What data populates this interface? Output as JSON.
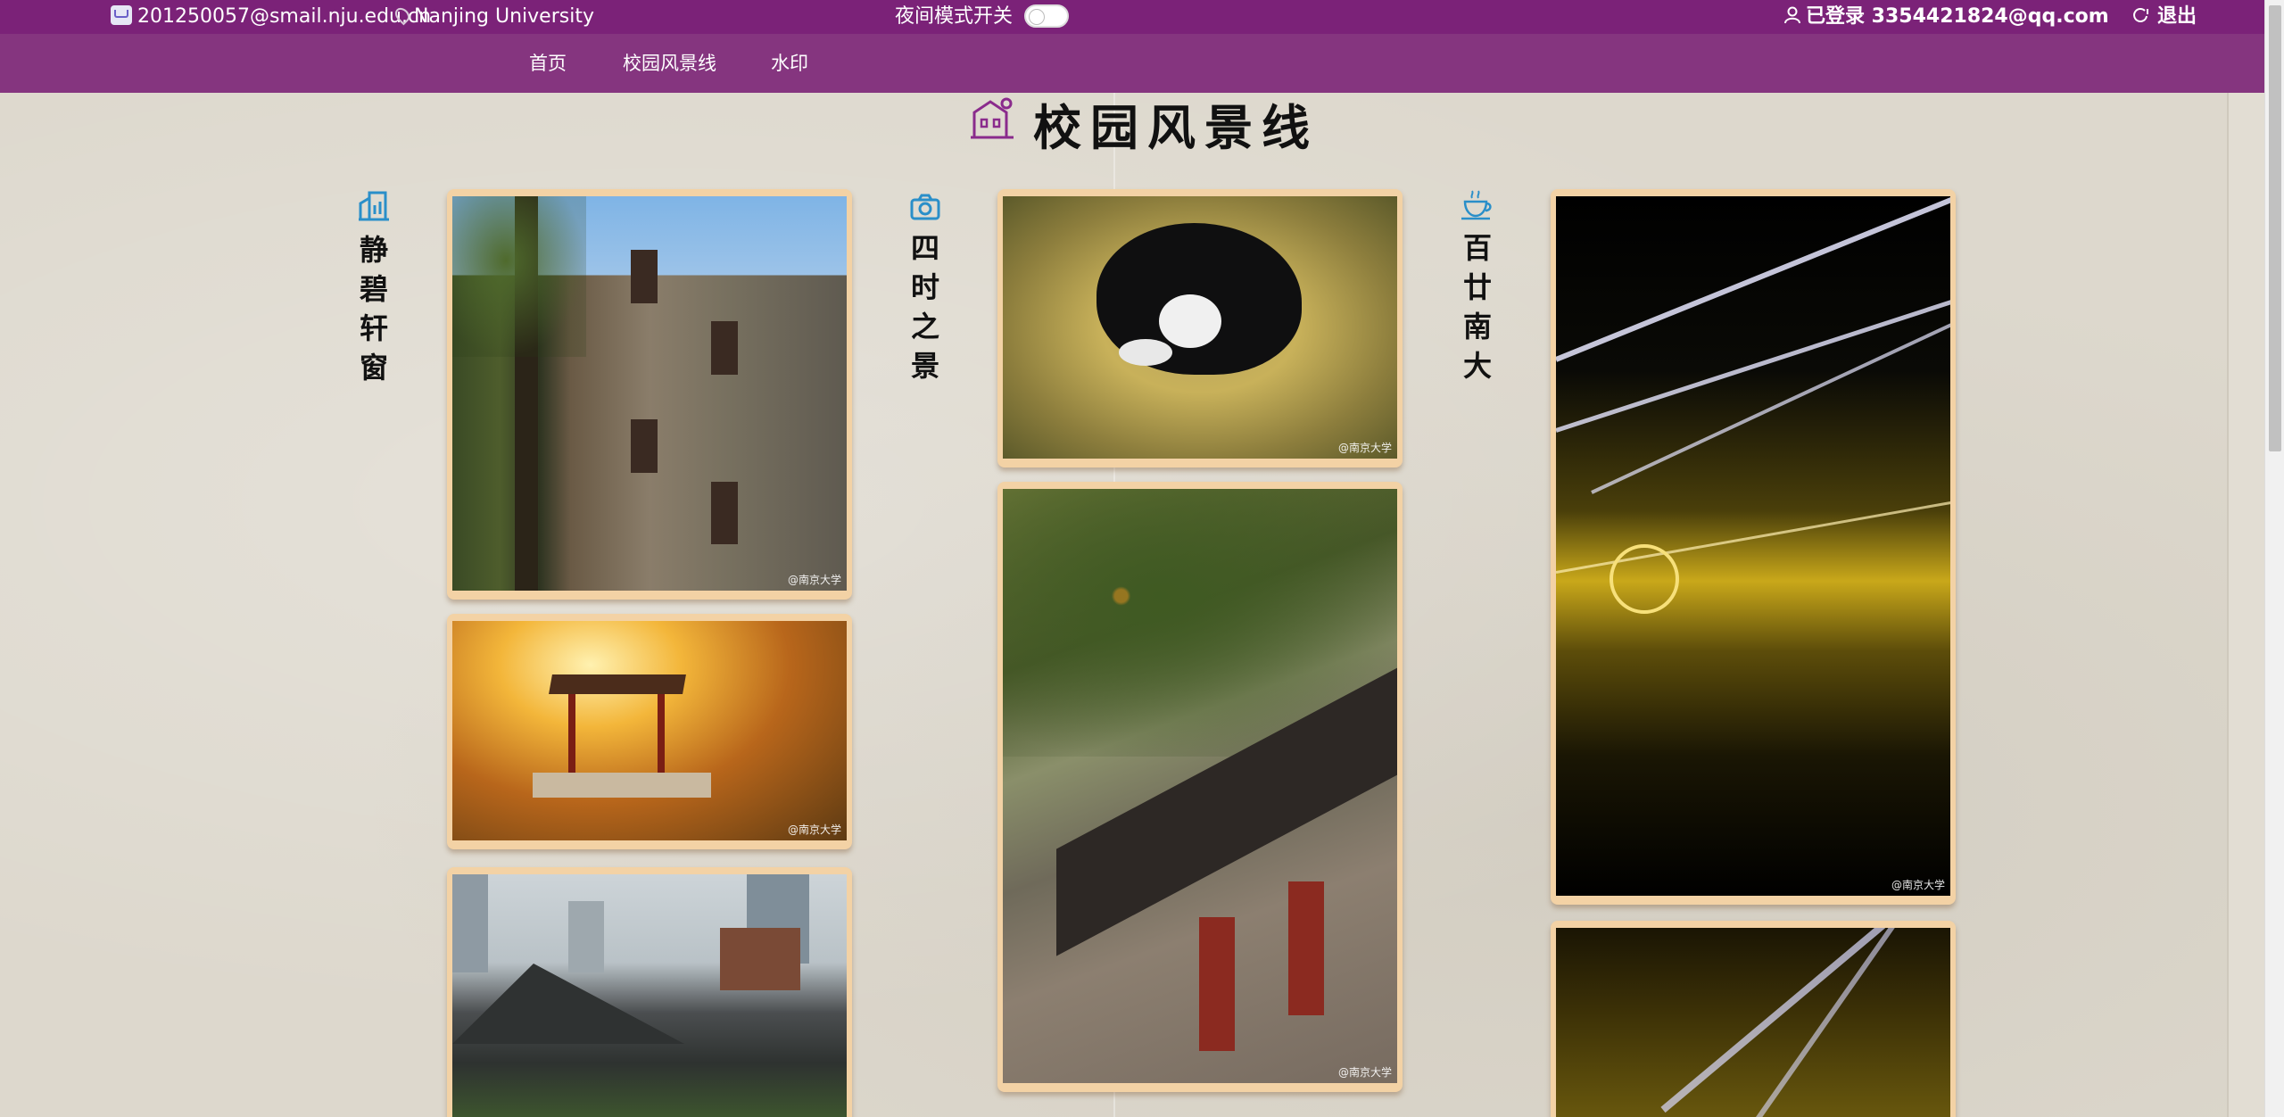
{
  "topbar": {
    "email": "201250057@smail.nju.edu.cn",
    "location": "Nanjing University",
    "night_mode_label": "夜间模式开关",
    "night_mode_on": false,
    "login_status": "已登录 3354421824@qq.com",
    "logout_label": "退出"
  },
  "nav": {
    "items": [
      {
        "label": "首页"
      },
      {
        "label": "校园风景线"
      },
      {
        "label": "水印"
      }
    ]
  },
  "page": {
    "title": "校园风景线",
    "title_icon": "building-icon"
  },
  "columns": [
    {
      "heading": [
        "静",
        "碧",
        "轩",
        "窗"
      ],
      "icon": "building-bars-icon"
    },
    {
      "heading": [
        "四",
        "时",
        "之",
        "景"
      ],
      "icon": "camera-icon"
    },
    {
      "heading": [
        "百",
        "廿",
        "南",
        "大"
      ],
      "icon": "teacup-icon"
    }
  ],
  "photos": {
    "watermark": "@南京大学",
    "col1": [
      {
        "subject": "brick-building-with-trees"
      },
      {
        "subject": "pavilion-autumn"
      },
      {
        "subject": "campus-rooftops-skyline"
      }
    ],
    "col2": [
      {
        "subject": "cat-on-ginkgo-leaves"
      },
      {
        "subject": "osmanthus-and-roof"
      }
    ],
    "col3": [
      {
        "subject": "light-show-night"
      },
      {
        "subject": "light-beams"
      }
    ]
  },
  "colors": {
    "topbar": "#7b2278",
    "navbar": "#85357f",
    "card_frame": "#f3d2a5",
    "accent_icon_purple": "#8a2b8c",
    "accent_icon_blue": "#2a8fc9"
  }
}
